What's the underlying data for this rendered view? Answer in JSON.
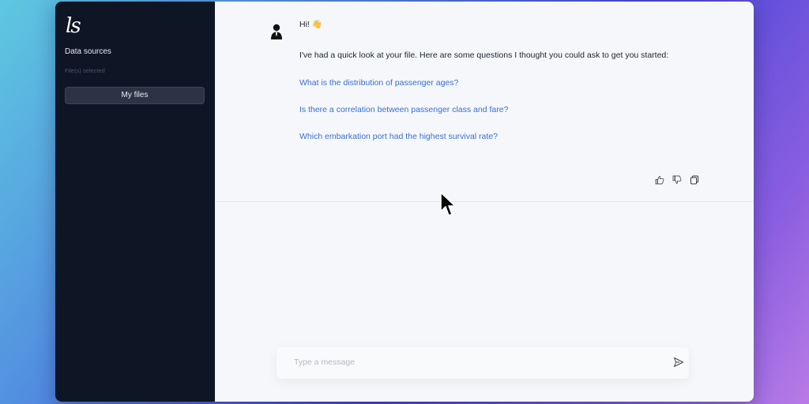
{
  "sidebar": {
    "logo": "ls",
    "data_sources_title": "Data sources",
    "files_selected": "File(s) selected",
    "my_files_button": "My files"
  },
  "chat": {
    "greeting": "Hi! 👋",
    "intro": "I've had a quick look at your file. Here are some questions I thought you could ask to get you started:",
    "questions": [
      "What is the distribution of passenger ages?",
      "Is there a correlation between passenger class and fare?",
      "Which embarkation port had the highest survival rate?"
    ]
  },
  "input": {
    "placeholder": "Type a message",
    "value": ""
  },
  "icons": {
    "avatar": "user-avatar-icon",
    "thumbs_up": "thumbs-up-icon",
    "thumbs_down": "thumbs-down-icon",
    "copy": "copy-icon",
    "send": "send-icon",
    "cursor": "mouse-pointer-icon"
  },
  "colors": {
    "sidebar_bg": "#0e1626",
    "main_bg": "#f5f7fa",
    "link": "#3a6fd1",
    "button_bg": "#2b3445"
  }
}
